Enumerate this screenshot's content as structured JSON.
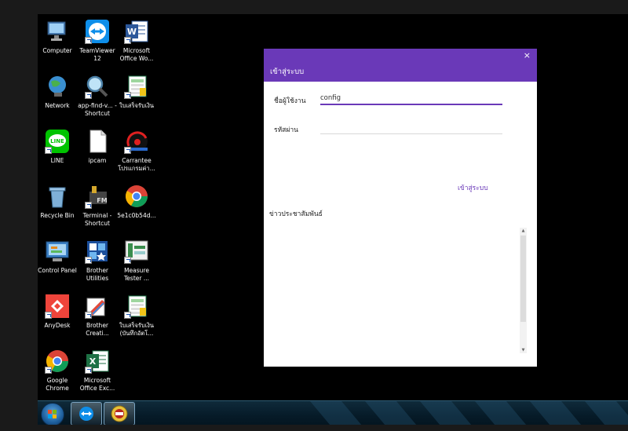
{
  "desktop": {
    "icons": [
      {
        "label": "Computer",
        "icon": "computer-icon"
      },
      {
        "label": "TeamViewer 12",
        "icon": "teamviewer-icon"
      },
      {
        "label": "Microsoft Office Wo...",
        "icon": "word-icon"
      },
      {
        "label": "Network",
        "icon": "network-icon"
      },
      {
        "label": "app-find-v... - Shortcut",
        "icon": "search-app-icon"
      },
      {
        "label": "ใบเสร็จรับเงิน",
        "icon": "excel-sheet-icon"
      },
      {
        "label": "LINE",
        "icon": "line-icon"
      },
      {
        "label": "ipcam",
        "icon": "file-icon"
      },
      {
        "label": "Carrantee โปรแกรมค่า...",
        "icon": "carrantee-icon"
      },
      {
        "label": "Recycle Bin",
        "icon": "recycle-bin-icon"
      },
      {
        "label": "Terminal - Shortcut",
        "icon": "terminal-icon"
      },
      {
        "label": "5e1c0b54d...",
        "icon": "chrome-icon"
      },
      {
        "label": "Control Panel",
        "icon": "control-panel-icon"
      },
      {
        "label": "Brother Utilities",
        "icon": "brother-utilities-icon"
      },
      {
        "label": "Measure Tester ...",
        "icon": "measure-tester-icon"
      },
      {
        "label": "AnyDesk",
        "icon": "anydesk-icon"
      },
      {
        "label": "Brother Creati...",
        "icon": "brother-creative-icon"
      },
      {
        "label": "ใบเสร็จรับเงิน (บันทึกอัตโ...",
        "icon": "excel-sheet-icon"
      },
      {
        "label": "Google Chrome",
        "icon": "chrome-icon"
      },
      {
        "label": "Microsoft Office Exc...",
        "icon": "excel-icon"
      }
    ]
  },
  "dialog": {
    "title": "เข้าสู่ระบบ",
    "close_glyph": "×",
    "username_label": "ชื่อผู้ใช้งาน",
    "username_value": "config",
    "password_label": "รหัสผ่าน",
    "password_value": "",
    "login_label": "เข้าสู่ระบบ",
    "news_label": "ข่าวประชาสัมพันธ์"
  },
  "taskbar": {
    "items": [
      {
        "name": "start-button",
        "icon": "windows-orb-icon"
      },
      {
        "name": "teamviewer",
        "icon": "teamviewer-icon"
      },
      {
        "name": "app-badge",
        "icon": "badge-app-icon"
      }
    ]
  },
  "colors": {
    "accent": "#6a39b8",
    "desktop_bg": "#000000"
  }
}
